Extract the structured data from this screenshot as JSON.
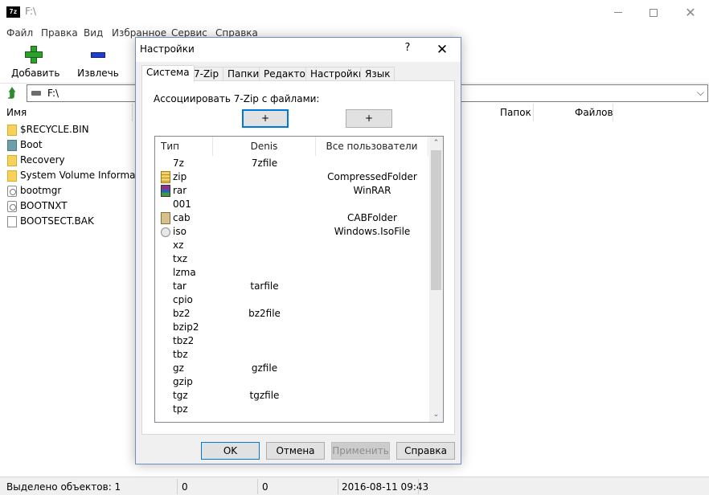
{
  "window": {
    "title": "F:\\"
  },
  "menu": [
    "Файл",
    "Правка",
    "Вид",
    "Избранное",
    "Сервис",
    "Справка"
  ],
  "toolbar": {
    "add_label": "Добавить",
    "extract_label": "Извлечь"
  },
  "address": {
    "path": "F:\\"
  },
  "columns": {
    "name": "Имя",
    "folders": "Папок",
    "files": "Файлов"
  },
  "files": [
    {
      "name": "$RECYCLE.BIN",
      "icon": "folder-icon"
    },
    {
      "name": "Boot",
      "icon": "system-folder-icon"
    },
    {
      "name": "Recovery",
      "icon": "folder-icon"
    },
    {
      "name": "System Volume Informa...",
      "icon": "folder-icon"
    },
    {
      "name": "bootmgr",
      "icon": "system-file-icon"
    },
    {
      "name": "BOOTNXT",
      "icon": "system-file-icon"
    },
    {
      "name": "BOOTSECT.BAK",
      "icon": "document-icon"
    }
  ],
  "status": {
    "selected": "Выделено объектов: 1",
    "size1": "0",
    "size2": "0",
    "datetime": "2016-08-11 09:43"
  },
  "dialog": {
    "title": "Настройки",
    "help_glyph": "?",
    "close_glyph": "✕",
    "tabs": [
      "Система",
      "7-Zip",
      "Папки",
      "Редактор",
      "Настройки",
      "Язык"
    ],
    "assoc_label": "Ассоциировать 7-Zip с файлами:",
    "assoc_user_btn": "+",
    "assoc_all_btn": "+",
    "list_headers": {
      "type": "Тип",
      "user": "Denis",
      "all": "Все пользователи"
    },
    "associations": [
      {
        "ext": "7z",
        "user": "7zfile",
        "all": ""
      },
      {
        "ext": "zip",
        "user": "",
        "all": "CompressedFolder",
        "icon": "zip"
      },
      {
        "ext": "rar",
        "user": "",
        "all": "WinRAR",
        "icon": "rar"
      },
      {
        "ext": "001",
        "user": "",
        "all": ""
      },
      {
        "ext": "cab",
        "user": "",
        "all": "CABFolder",
        "icon": "cab"
      },
      {
        "ext": "iso",
        "user": "",
        "all": "Windows.IsoFile",
        "icon": "iso"
      },
      {
        "ext": "xz",
        "user": "",
        "all": ""
      },
      {
        "ext": "txz",
        "user": "",
        "all": ""
      },
      {
        "ext": "lzma",
        "user": "",
        "all": ""
      },
      {
        "ext": "tar",
        "user": "tarfile",
        "all": ""
      },
      {
        "ext": "cpio",
        "user": "",
        "all": ""
      },
      {
        "ext": "bz2",
        "user": "bz2file",
        "all": ""
      },
      {
        "ext": "bzip2",
        "user": "",
        "all": ""
      },
      {
        "ext": "tbz2",
        "user": "",
        "all": ""
      },
      {
        "ext": "tbz",
        "user": "",
        "all": ""
      },
      {
        "ext": "gz",
        "user": "gzfile",
        "all": ""
      },
      {
        "ext": "gzip",
        "user": "",
        "all": ""
      },
      {
        "ext": "tgz",
        "user": "tgzfile",
        "all": ""
      },
      {
        "ext": "tpz",
        "user": "",
        "all": ""
      }
    ],
    "buttons": {
      "ok": "OK",
      "cancel": "Отмена",
      "apply": "Применить",
      "help": "Справка"
    }
  },
  "colors": {
    "accent": "#0078d7",
    "dialog_border": "#6f8dbe",
    "add_icon": "#2ea02e",
    "extract_icon": "#1f3fd1"
  }
}
